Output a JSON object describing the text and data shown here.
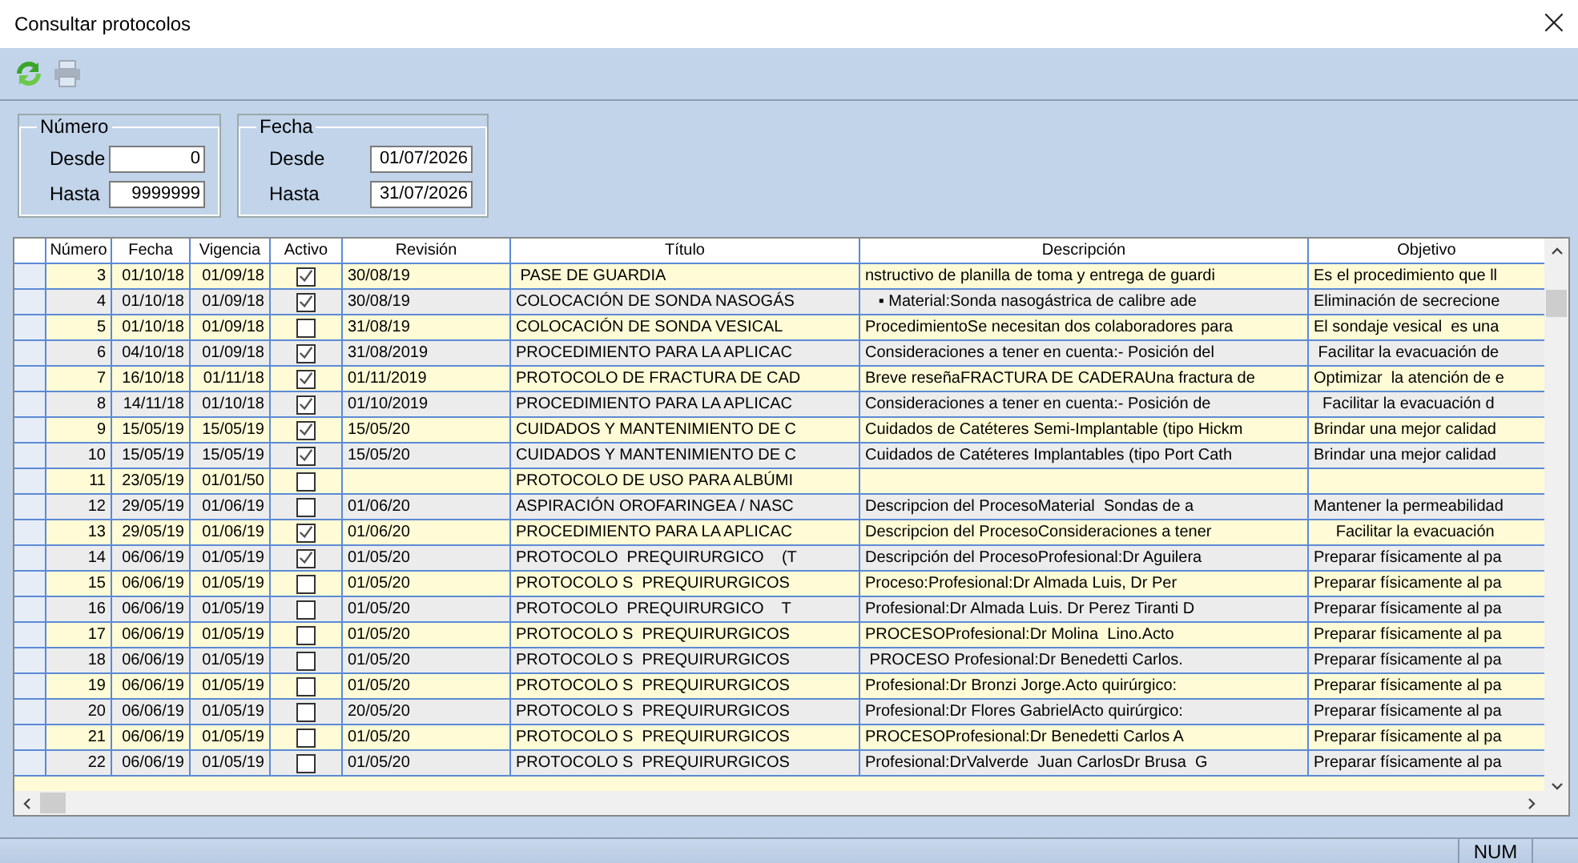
{
  "window": {
    "title": "Consultar protocolos",
    "close": "×"
  },
  "toolbar": [
    {
      "kind": "refresh",
      "disabled": false
    },
    {
      "kind": "print",
      "disabled": true
    }
  ],
  "filters": [
    {
      "legend": "Número",
      "fields": [
        {
          "label": "Desde",
          "value": "0"
        },
        {
          "label": "Hasta",
          "value": "9999999"
        }
      ]
    },
    {
      "legend": "Fecha",
      "fields": [
        {
          "label": "Desde",
          "value": "01/07/2026"
        },
        {
          "label": "Hasta",
          "value": "31/07/2026"
        }
      ]
    }
  ],
  "table": {
    "columns": [
      {
        "label": "Número",
        "kind": "num"
      },
      {
        "label": "Fecha",
        "kind": "num"
      },
      {
        "label": "Vigencia",
        "kind": "num"
      },
      {
        "label": "Activo",
        "kind": "check"
      },
      {
        "label": "Revisión",
        "kind": "text"
      },
      {
        "label": "Título",
        "kind": "text"
      },
      {
        "label": "Descripción",
        "kind": "text"
      },
      {
        "label": "Objetivo",
        "kind": "text"
      }
    ],
    "rows": [
      {
        "cells": [
          "3",
          "01/10/18",
          "01/09/18",
          true,
          "30/08/19",
          " PASE DE GUARDIA",
          "nstructivo de planilla de toma y entrega de guardi",
          "Es el procedimiento que ll"
        ]
      },
      {
        "cells": [
          "4",
          "01/10/18",
          "01/09/18",
          true,
          "30/08/19",
          "COLOCACIÓN DE SONDA NASOGÁS",
          "   ▪ Material:Sonda nasogástrica de calibre ade",
          "Eliminación de secrecione"
        ]
      },
      {
        "cells": [
          "5",
          "01/10/18",
          "01/09/18",
          false,
          "31/08/19",
          "COLOCACIÓN DE SONDA VESICAL",
          "ProcedimientoSe necesitan dos colaboradores para",
          "El sondaje vesical  es una"
        ]
      },
      {
        "cells": [
          "6",
          "04/10/18",
          "01/09/18",
          true,
          "31/08/2019",
          "PROCEDIMIENTO PARA LA APLICAC",
          "Consideraciones a tener en cuenta:- Posición del",
          " Facilitar la evacuación de"
        ]
      },
      {
        "cells": [
          "7",
          "16/10/18",
          "01/11/18",
          true,
          "01/11/2019",
          "PROTOCOLO DE FRACTURA DE CAD",
          "Breve reseñaFRACTURA DE CADERAUna fractura de",
          "Optimizar  la atención de e"
        ]
      },
      {
        "cells": [
          "8",
          "14/11/18",
          "01/10/18",
          true,
          "01/10/2019",
          "PROCEDIMIENTO PARA LA APLICAC",
          "Consideraciones a tener en cuenta:- Posición de",
          "  Facilitar la evacuación d"
        ]
      },
      {
        "cells": [
          "9",
          "15/05/19",
          "15/05/19",
          true,
          "15/05/20",
          "CUIDADOS Y MANTENIMIENTO DE C",
          "Cuidados de Catéteres Semi-Implantable (tipo Hickm",
          "Brindar una mejor calidad"
        ]
      },
      {
        "cells": [
          "10",
          "15/05/19",
          "15/05/19",
          true,
          "15/05/20",
          "CUIDADOS Y MANTENIMIENTO DE C",
          "Cuidados de Catéteres Implantables (tipo Port Cath",
          "Brindar una mejor calidad"
        ]
      },
      {
        "cells": [
          "11",
          "23/05/19",
          "01/01/50",
          false,
          "",
          "PROTOCOLO DE USO PARA ALBÚMI",
          "",
          ""
        ]
      },
      {
        "cells": [
          "12",
          "29/05/19",
          "01/06/19",
          false,
          "01/06/20",
          "ASPIRACIÓN OROFARINGEA / NASC",
          "Descripcion del ProcesoMaterial  Sondas de a",
          "Mantener la permeabilidad"
        ]
      },
      {
        "cells": [
          "13",
          "29/05/19",
          "01/06/19",
          true,
          "01/06/20",
          "PROCEDIMIENTO PARA LA APLICAC",
          "Descripcion del ProcesoConsideraciones a tener",
          "     Facilitar la evacuación"
        ]
      },
      {
        "cells": [
          "14",
          "06/06/19",
          "01/05/19",
          true,
          "01/05/20",
          "PROTOCOLO  PREQUIRURGICO    (T",
          "Descripción del ProcesoProfesional:Dr Aguilera",
          "Preparar físicamente al pa"
        ]
      },
      {
        "cells": [
          "15",
          "06/06/19",
          "01/05/19",
          false,
          "01/05/20",
          "PROTOCOLO S  PREQUIRURGICOS",
          "Proceso:Profesional:Dr Almada Luis, Dr Per",
          "Preparar físicamente al pa"
        ]
      },
      {
        "cells": [
          "16",
          "06/06/19",
          "01/05/19",
          false,
          "01/05/20",
          "PROTOCOLO  PREQUIRURGICO    T",
          "Profesional:Dr Almada Luis. Dr Perez Tiranti D",
          "Preparar físicamente al pa"
        ]
      },
      {
        "cells": [
          "17",
          "06/06/19",
          "01/05/19",
          false,
          "01/05/20",
          "PROTOCOLO S  PREQUIRURGICOS",
          "PROCESOProfesional:Dr Molina  Lino.Acto",
          "Preparar físicamente al pa"
        ]
      },
      {
        "cells": [
          "18",
          "06/06/19",
          "01/05/19",
          false,
          "01/05/20",
          "PROTOCOLO S  PREQUIRURGICOS",
          " PROCESO Profesional:Dr Benedetti Carlos.",
          "Preparar físicamente al pa"
        ]
      },
      {
        "cells": [
          "19",
          "06/06/19",
          "01/05/19",
          false,
          "01/05/20",
          "PROTOCOLO S  PREQUIRURGICOS",
          "Profesional:Dr Bronzi Jorge.Acto quirúrgico:",
          "Preparar físicamente al pa"
        ]
      },
      {
        "cells": [
          "20",
          "06/06/19",
          "01/05/19",
          false,
          "20/05/20",
          "PROTOCOLO S  PREQUIRURGICOS",
          "Profesional:Dr Flores GabrielActo quirúrgico:",
          "Preparar físicamente al pa"
        ]
      },
      {
        "cells": [
          "21",
          "06/06/19",
          "01/05/19",
          false,
          "01/05/20",
          "PROTOCOLO S  PREQUIRURGICOS",
          "PROCESOProfesional:Dr Benedetti Carlos A",
          "Preparar físicamente al pa"
        ]
      },
      {
        "cells": [
          "22",
          "06/06/19",
          "01/05/19",
          false,
          "01/05/20",
          "PROTOCOLO S  PREQUIRURGICOS",
          "Profesional:DrValverde  Juan CarlosDr Brusa  G",
          "Preparar físicamente al pa"
        ]
      }
    ]
  },
  "status_bar": {
    "indicator": "NUM"
  }
}
